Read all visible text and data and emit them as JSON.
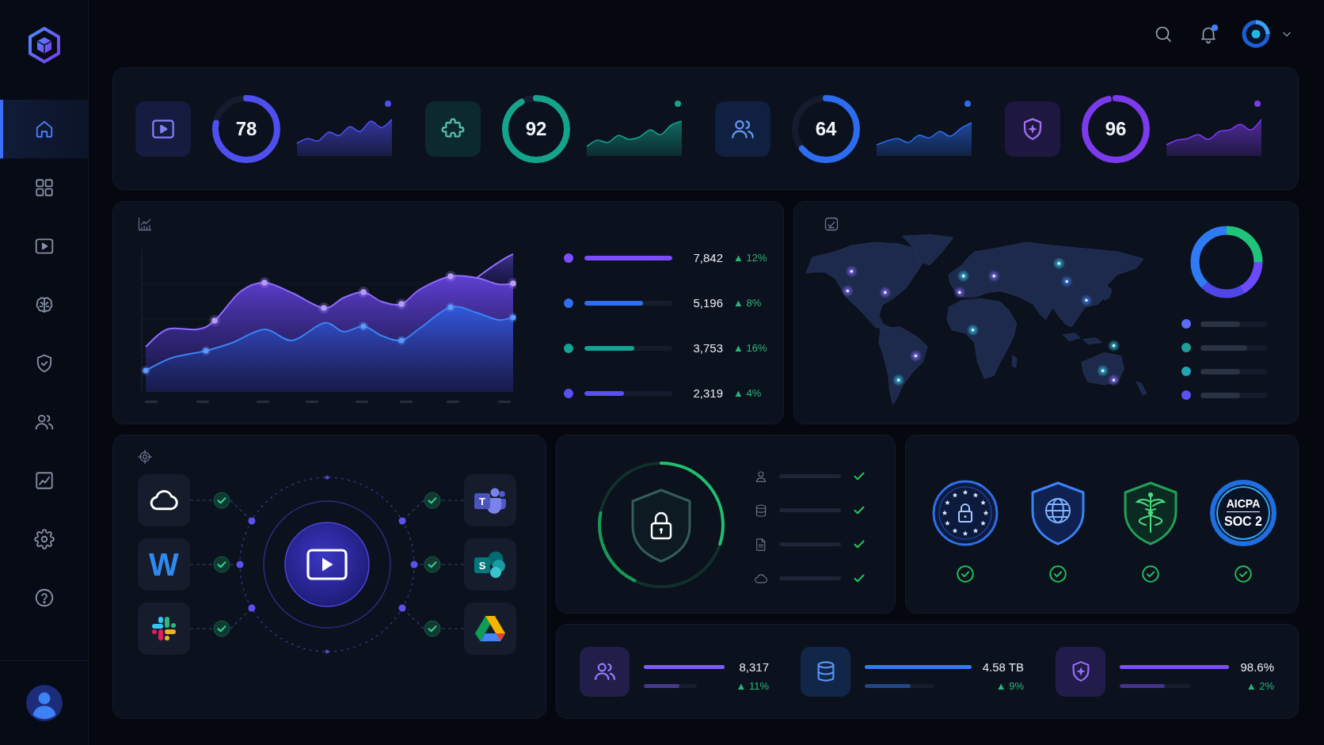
{
  "sidebar": {
    "items": [
      {
        "kind": "home",
        "selected": true
      },
      {
        "kind": "grid",
        "selected": false
      },
      {
        "kind": "video",
        "selected": false
      },
      {
        "kind": "brain",
        "selected": false
      },
      {
        "kind": "shield",
        "selected": false
      },
      {
        "kind": "users",
        "selected": false
      },
      {
        "kind": "chart",
        "selected": false
      },
      {
        "kind": "settings",
        "selected": false
      },
      {
        "kind": "help",
        "selected": false
      }
    ]
  },
  "top_bar": {
    "notifications": {
      "unread": true
    }
  },
  "kpis": [
    {
      "kind": "video",
      "value": "78",
      "level": 0.78,
      "color": "#4f4ff0"
    },
    {
      "kind": "puzzle",
      "value": "92",
      "level": 0.92,
      "color": "#14a38b"
    },
    {
      "kind": "users",
      "value": "64",
      "level": 0.64,
      "color": "#2b6cf0"
    },
    {
      "kind": "shield",
      "value": "96",
      "level": 0.96,
      "color": "#7c3aed"
    }
  ],
  "traffic": {
    "legend": [
      {
        "color": "#7c4dff",
        "level": 1,
        "value": "7,842",
        "change": "▲ 12%"
      },
      {
        "color": "#2f6ff0",
        "level": 0.67,
        "value": "5,196",
        "change": "▲ 8%"
      },
      {
        "color": "#14a394",
        "level": 0.57,
        "value": "3,753",
        "change": "▲ 16%"
      },
      {
        "color": "#5a4ff0",
        "level": 0.45,
        "value": "2,319",
        "change": "▲ 4%"
      }
    ]
  },
  "regions": {
    "legend": [
      {
        "color": "#5b6cf5",
        "level": 0.6
      },
      {
        "color": "#1f9e9a",
        "level": 0.7
      },
      {
        "color": "#22a6b3",
        "level": 0.6
      },
      {
        "color": "#5b50f0",
        "level": 0.6
      }
    ]
  },
  "integrations": {
    "left": [
      {
        "kind": "cloud",
        "connected": true
      },
      {
        "kind": "letter",
        "letter": "W",
        "connected": true
      },
      {
        "kind": "pinwheel",
        "connected": true
      }
    ],
    "right": [
      {
        "kind": "people-letter",
        "letter": "T",
        "connected": true
      },
      {
        "kind": "circles-letter",
        "letter": "S",
        "connected": true
      },
      {
        "kind": "triangle",
        "connected": true
      }
    ]
  },
  "security": {
    "checks": [
      {
        "kind": "user",
        "checked": true
      },
      {
        "kind": "database",
        "checked": true
      },
      {
        "kind": "file",
        "checked": true
      },
      {
        "kind": "cloud",
        "checked": true
      }
    ]
  },
  "certifications": [
    {
      "kind": "star-seal",
      "verified": true
    },
    {
      "kind": "globe-shield",
      "verified": true
    },
    {
      "kind": "caduceus-shield",
      "verified": true
    },
    {
      "kind": "text-seal",
      "lines": [
        "AICPA",
        "SOC 2"
      ],
      "verified": true
    }
  ],
  "stats": [
    {
      "kind": "users",
      "color": "#7c5cff",
      "value": "8,317",
      "change": "▲ 11%",
      "level": 0.67
    },
    {
      "kind": "database",
      "color": "#2f7bf5",
      "value": "4.58 TB",
      "change": "▲ 9%",
      "level": 0.66
    },
    {
      "kind": "shield",
      "color": "#7c4dff",
      "value": "98.6%",
      "change": "▲ 2%",
      "level": 0.63
    }
  ]
}
